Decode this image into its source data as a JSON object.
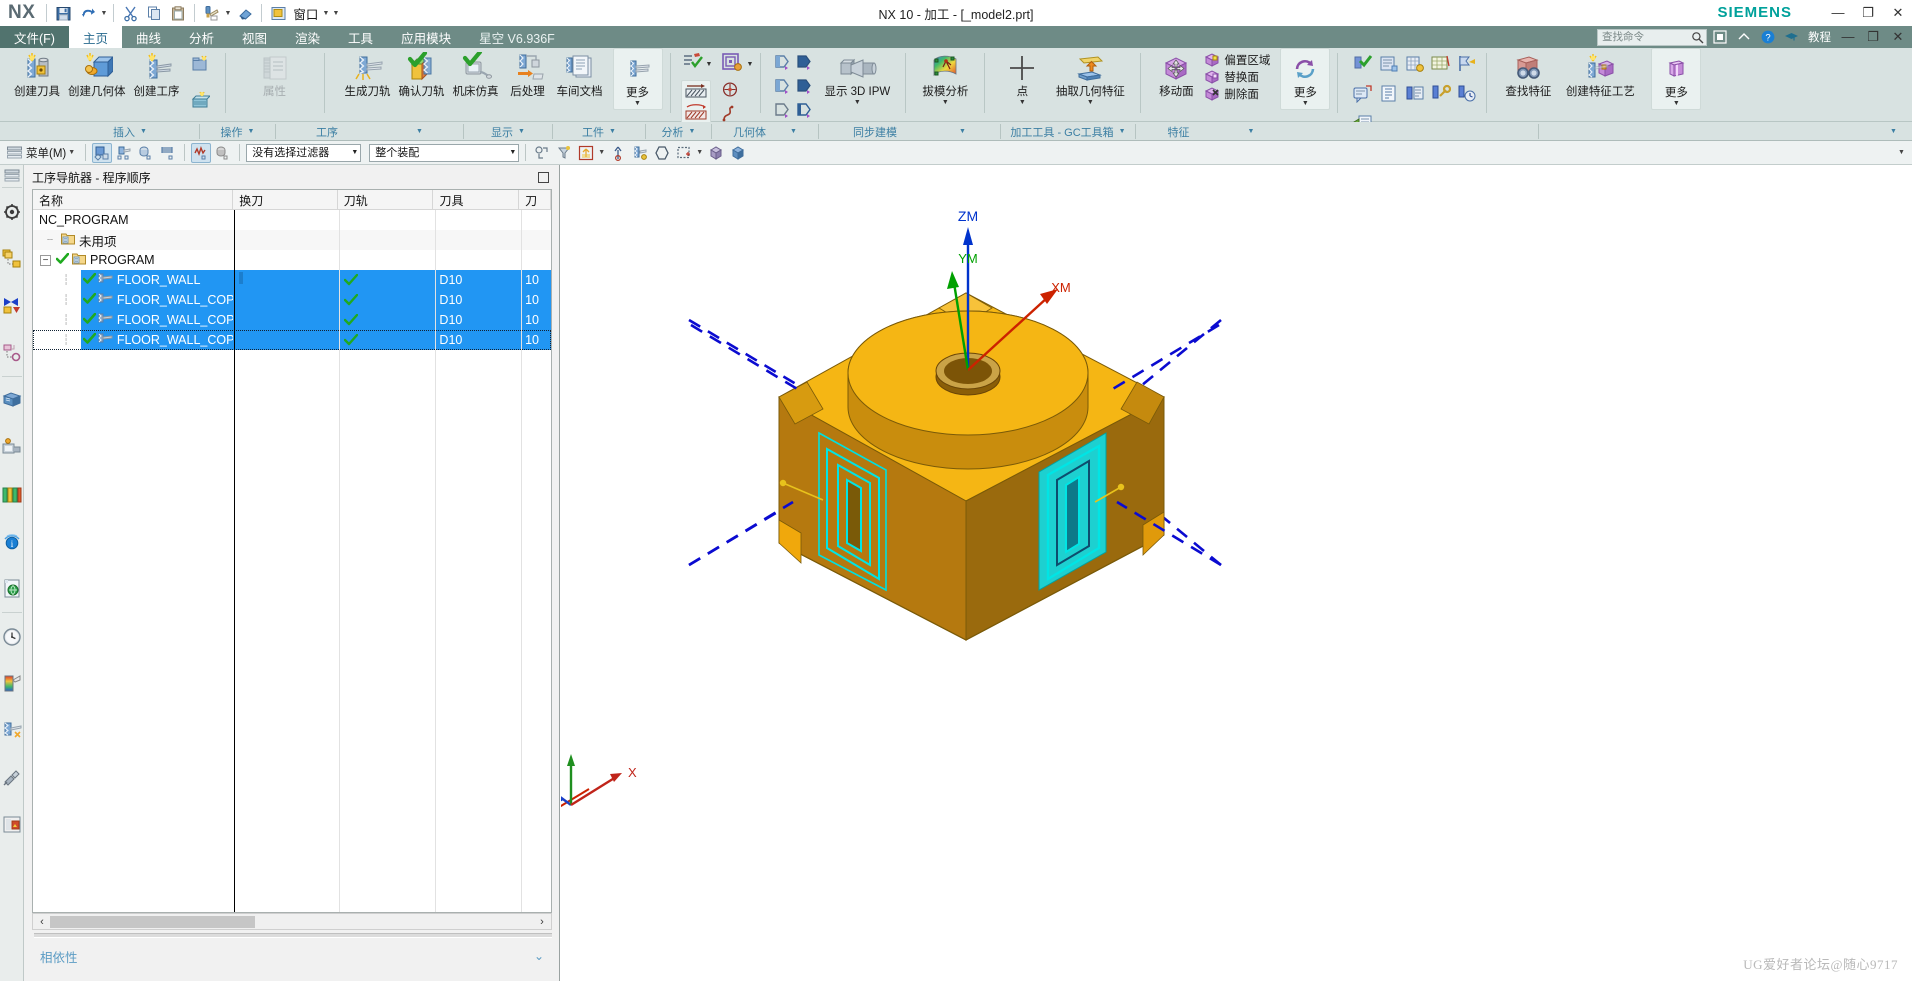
{
  "window": {
    "app_name": "NX",
    "title": "NX 10 - 加工 - [_model2.prt]",
    "brand": "SIEMENS",
    "minimize": "—",
    "maximize": "❐",
    "close": "✕"
  },
  "quick_access": {
    "items": [
      {
        "name": "save-icon",
        "label": "保存"
      },
      {
        "name": "undo-icon",
        "label": "撤销"
      },
      {
        "name": "cut-icon",
        "label": "剪切"
      },
      {
        "name": "copy-icon",
        "label": "复制"
      },
      {
        "name": "paste-icon",
        "label": "粘贴"
      },
      {
        "name": "format-painter-icon",
        "label": "格式刷"
      },
      {
        "name": "eraser-icon",
        "label": "擦除"
      }
    ],
    "window_menu_label": "窗口"
  },
  "tabs": [
    {
      "label": "文件(F)",
      "active": false,
      "kind": "file"
    },
    {
      "label": "主页",
      "active": true,
      "kind": "normal"
    },
    {
      "label": "曲线",
      "active": false,
      "kind": "normal"
    },
    {
      "label": "分析",
      "active": false,
      "kind": "normal"
    },
    {
      "label": "视图",
      "active": false,
      "kind": "normal"
    },
    {
      "label": "渲染",
      "active": false,
      "kind": "normal"
    },
    {
      "label": "工具",
      "active": false,
      "kind": "normal"
    },
    {
      "label": "应用模块",
      "active": false,
      "kind": "normal"
    },
    {
      "label": "星空 V6.936F",
      "active": false,
      "kind": "plugin"
    }
  ],
  "search": {
    "placeholder": "查找命令"
  },
  "ribbon_right": {
    "tutorial_label": "教程",
    "help_label": "?",
    "minimize": "—",
    "restore": "❐",
    "close": "✕"
  },
  "ribbon": {
    "groups": [
      {
        "name": "插入",
        "label": "插入",
        "items": [
          {
            "name": "create-tool",
            "label": "创建刀具",
            "icon": "tool-create-icon"
          },
          {
            "name": "create-geometry",
            "label": "创建几何体",
            "icon": "geometry-create-icon"
          },
          {
            "name": "create-operation",
            "label": "创建工序",
            "icon": "operation-create-icon"
          }
        ],
        "small_items": [
          {
            "name": "create-program-group",
            "icon": "program-group-icon"
          },
          {
            "name": "create-method-group",
            "icon": "method-group-icon"
          }
        ]
      },
      {
        "name": "操作",
        "label": "操作",
        "items": [
          {
            "name": "attributes",
            "label": "属性",
            "icon": "attributes-icon",
            "disabled": true
          }
        ]
      },
      {
        "name": "工序",
        "label": "工序",
        "items": [
          {
            "name": "generate-toolpath",
            "label": "生成刀轨",
            "icon": "generate-toolpath-icon"
          },
          {
            "name": "verify-toolpath",
            "label": "确认刀轨",
            "icon": "verify-toolpath-icon"
          },
          {
            "name": "machine-simulation",
            "label": "机床仿真",
            "icon": "machine-sim-icon"
          },
          {
            "name": "post-process",
            "label": "后处理",
            "icon": "post-process-icon"
          },
          {
            "name": "shop-documentation",
            "label": "车间文档",
            "icon": "shop-doc-icon"
          },
          {
            "name": "more-operations",
            "label": "更多",
            "icon": "more-operations-icon"
          }
        ]
      },
      {
        "name": "显示",
        "label": "显示",
        "items": [
          {
            "name": "display-toolpath",
            "icon": "toolpath-display-icon"
          },
          {
            "name": "display-dropdown",
            "icon": "display-dropdown-icon"
          },
          {
            "name": "show-blank",
            "icon": "blank-hatch-icon"
          },
          {
            "name": "show-part",
            "icon": "part-hatch-icon"
          },
          {
            "name": "display-point",
            "icon": "point-target-icon"
          },
          {
            "name": "display-curve",
            "icon": "spline-curve-icon"
          }
        ]
      },
      {
        "name": "工件",
        "label": "工件",
        "items": [
          {
            "name": "show-3d-ipw",
            "label": "显示 3D IPW",
            "icon": "ipw-icon"
          }
        ]
      },
      {
        "name": "分析",
        "label": "分析",
        "items": [
          {
            "name": "draft-analysis",
            "label": "拔模分析",
            "icon": "draft-analysis-icon"
          }
        ]
      },
      {
        "name": "几何体",
        "label": "几何体",
        "items": [
          {
            "name": "point",
            "label": "点",
            "icon": "point-icon"
          },
          {
            "name": "extract-geometry",
            "label": "抽取几何特征",
            "icon": "extract-geometry-icon"
          }
        ]
      },
      {
        "name": "同步建模",
        "label": "同步建模",
        "items": [
          {
            "name": "move-face",
            "label": "移动面",
            "icon": "move-face-icon"
          },
          {
            "name": "offset-region",
            "label": "偏置区域",
            "icon": "offset-region-icon"
          },
          {
            "name": "replace-face",
            "label": "替换面",
            "icon": "replace-face-icon"
          },
          {
            "name": "delete-face",
            "label": "删除面",
            "icon": "delete-face-icon"
          },
          {
            "name": "more-sync",
            "label": "更多",
            "icon": "more-sync-icon"
          }
        ]
      },
      {
        "name": "加工工具 - GC工具箱",
        "label": "加工工具 - GC工具箱",
        "items": []
      },
      {
        "name": "特征",
        "label": "特征",
        "items": [
          {
            "name": "find-feature",
            "label": "查找特征",
            "icon": "find-feature-icon"
          },
          {
            "name": "create-feature-process",
            "label": "创建特征工艺",
            "icon": "create-feature-process-icon"
          },
          {
            "name": "more-feature",
            "label": "更多",
            "icon": "more-feature-icon"
          }
        ]
      }
    ]
  },
  "toolbar2": {
    "menu_label": "菜单(M)",
    "selection_filter": "没有选择过滤器",
    "assembly_scope": "整个装配",
    "buttons": [
      {
        "name": "select-general-objects",
        "selected": true
      },
      {
        "name": "select-features"
      },
      {
        "name": "select-components"
      },
      {
        "name": "select-faces"
      },
      {
        "name": "class-selection",
        "selected": true
      },
      {
        "name": "deselect"
      },
      {
        "name": "snap-point"
      },
      {
        "name": "snap-filter"
      },
      {
        "name": "wcs-display"
      },
      {
        "name": "wcs-origin"
      },
      {
        "name": "wcs-dynamics"
      },
      {
        "name": "hide-object"
      },
      {
        "name": "rectangle-select"
      },
      {
        "name": "shaded-view"
      },
      {
        "name": "solid-view"
      }
    ]
  },
  "left_rail": {
    "items": [
      {
        "name": "rail-menu-icon",
        "label": "菜单"
      },
      {
        "name": "rail-assembly-navigator-icon",
        "label": "装配导航器"
      },
      {
        "name": "rail-constraint-navigator-icon",
        "label": "约束导航器"
      },
      {
        "name": "rail-part-navigator-icon",
        "label": "部件导航器"
      },
      {
        "name": "rail-operation-navigator-icon",
        "label": "工序导航器"
      },
      {
        "name": "rail-reuse-library-icon",
        "label": "重用库"
      },
      {
        "name": "rail-machining-wizard-icon",
        "label": "加工特征导航器"
      },
      {
        "name": "rail-manufacturing-library-icon",
        "label": "制造资源库"
      },
      {
        "name": "rail-internet-explorer-icon",
        "label": "HD3D 工具"
      },
      {
        "name": "rail-web-browser-icon",
        "label": "Web 浏览器"
      },
      {
        "name": "rail-history-icon",
        "label": "历史记录"
      },
      {
        "name": "rail-system-materials-icon",
        "label": "系统材料"
      },
      {
        "name": "rail-process-studio-icon",
        "label": "加工向导"
      },
      {
        "name": "rail-roles-icon",
        "label": "角色"
      },
      {
        "name": "rail-system-scenes-icon",
        "label": "系统场景"
      }
    ]
  },
  "navigator": {
    "title": "工序导航器 - 程序顺序",
    "columns": [
      {
        "key": "name",
        "label": "名称"
      },
      {
        "key": "change_tool",
        "label": "换刀"
      },
      {
        "key": "toolpath",
        "label": "刀轨"
      },
      {
        "key": "tool",
        "label": "刀具"
      },
      {
        "key": "tool_num",
        "label": "刀"
      }
    ],
    "rows": [
      {
        "name": "NC_PROGRAM",
        "indent": 0,
        "type": "root",
        "selected": false,
        "change_tool": "",
        "toolpath": "",
        "tool": "",
        "tool_num": ""
      },
      {
        "name": "未用项",
        "indent": 1,
        "type": "folder",
        "selected": false,
        "change_tool": "",
        "toolpath": "",
        "tool": "",
        "tool_num": ""
      },
      {
        "name": "PROGRAM",
        "indent": 1,
        "type": "folder-expanded",
        "checked": true,
        "selected": false,
        "change_tool": "",
        "toolpath": "",
        "tool": "",
        "tool_num": ""
      },
      {
        "name": "FLOOR_WALL",
        "indent": 2,
        "type": "operation",
        "checked": true,
        "selected": true,
        "change_tool": "edit",
        "toolpath": "done",
        "tool": "D10",
        "tool_num": "10"
      },
      {
        "name": "FLOOR_WALL_COPY",
        "indent": 2,
        "type": "operation",
        "checked": true,
        "selected": true,
        "change_tool": "",
        "toolpath": "done",
        "tool": "D10",
        "tool_num": "10"
      },
      {
        "name": "FLOOR_WALL_COPY...",
        "indent": 2,
        "type": "operation",
        "checked": true,
        "selected": true,
        "change_tool": "",
        "toolpath": "done",
        "tool": "D10",
        "tool_num": "10"
      },
      {
        "name": "FLOOR_WALL_COPY...",
        "indent": 2,
        "type": "operation",
        "checked": true,
        "selected": true,
        "focus": true,
        "change_tool": "",
        "toolpath": "done",
        "tool": "D10",
        "tool_num": "10"
      }
    ],
    "dependencies_label": "相依性",
    "scroll_left": "‹",
    "scroll_right": "›"
  },
  "viewport": {
    "axis_labels": {
      "zm": "ZM",
      "ym": "YM",
      "xm": "XM",
      "triad_x": "X"
    },
    "colors": {
      "part_top": "#f5b614",
      "part_front": "#c38210",
      "part_side": "#a56b0c",
      "toolpath_cyan": "#00e5e5",
      "toolpath_blue": "#0000d0",
      "axis_z": "#0033cc",
      "axis_y": "#00a000",
      "axis_x": "#cc2200"
    },
    "watermark": "UG爱好者论坛@随心9717"
  }
}
